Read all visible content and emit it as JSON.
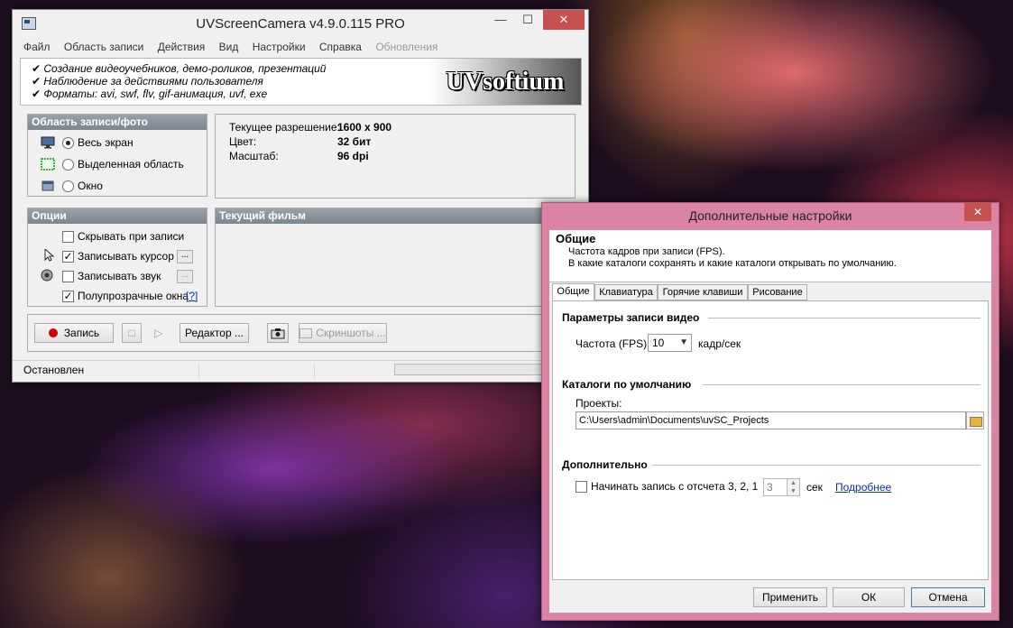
{
  "main": {
    "title": "UVScreenCamera v4.9.0.115 PRO",
    "minimize": "—",
    "maximize": "☐",
    "close": "✕",
    "menu": [
      "Файл",
      "Область записи",
      "Действия",
      "Вид",
      "Настройки",
      "Справка",
      "Обновления"
    ],
    "banner": {
      "lines": [
        "✔ Создание видеоучебников, демо-роликов, презентаций",
        "✔ Наблюдение за действиями пользователя",
        "✔ Форматы: avi, swf, flv, gif-анимация, uvf, exe"
      ],
      "logo": "UVsoftium"
    },
    "area_group": {
      "title": "Область записи/фото",
      "options": [
        "Весь экран",
        "Выделенная область",
        "Окно"
      ],
      "selected": 0
    },
    "info": {
      "resolution_label": "Текущее разрешение:",
      "resolution_value": "1600 x 900",
      "color_label": "Цвет:",
      "color_value": "32 бит",
      "scale_label": "Масштаб:",
      "scale_value": "96 dpi"
    },
    "options_group": {
      "title": "Опции",
      "hide_label": "Скрывать при записи",
      "cursor_label": "Записывать курсор",
      "sound_label": "Записывать звук",
      "transparent_label": "Полупрозрачные окна",
      "more_btn": "...",
      "help_link": "[?]"
    },
    "movie_group": {
      "title": "Текущий фильм"
    },
    "toolbar": {
      "record": "Запись",
      "stop": "□",
      "play": "▷",
      "editor": "Редактор ...",
      "screenshots": "Скриншоты ..."
    },
    "status": "Остановлен"
  },
  "dialog": {
    "title": "Дополнительные настройки",
    "close": "✕",
    "header_title": "Общие",
    "header_line1": "Частота кадров при записи (FPS).",
    "header_line2": "В какие каталоги сохранять и какие каталоги открывать по умолчанию.",
    "tabs": [
      "Общие",
      "Клавиатура",
      "Горячие клавиши",
      "Рисование"
    ],
    "video_section": "Параметры записи видео",
    "fps_label": "Частота (FPS):",
    "fps_value": "10",
    "fps_unit": "кадр/сек",
    "dirs_section": "Каталоги по умолчанию",
    "projects_label": "Проекты:",
    "projects_path": "C:\\Users\\admin\\Documents\\uvSC_Projects",
    "extra_section": "Дополнительно",
    "countdown_label": "Начинать запись с отсчета 3, 2, 1",
    "countdown_value": "3",
    "countdown_unit": "сек",
    "more_link": "Подробнее",
    "apply": "Применить",
    "ok": "ОК",
    "cancel": "Отмена"
  }
}
